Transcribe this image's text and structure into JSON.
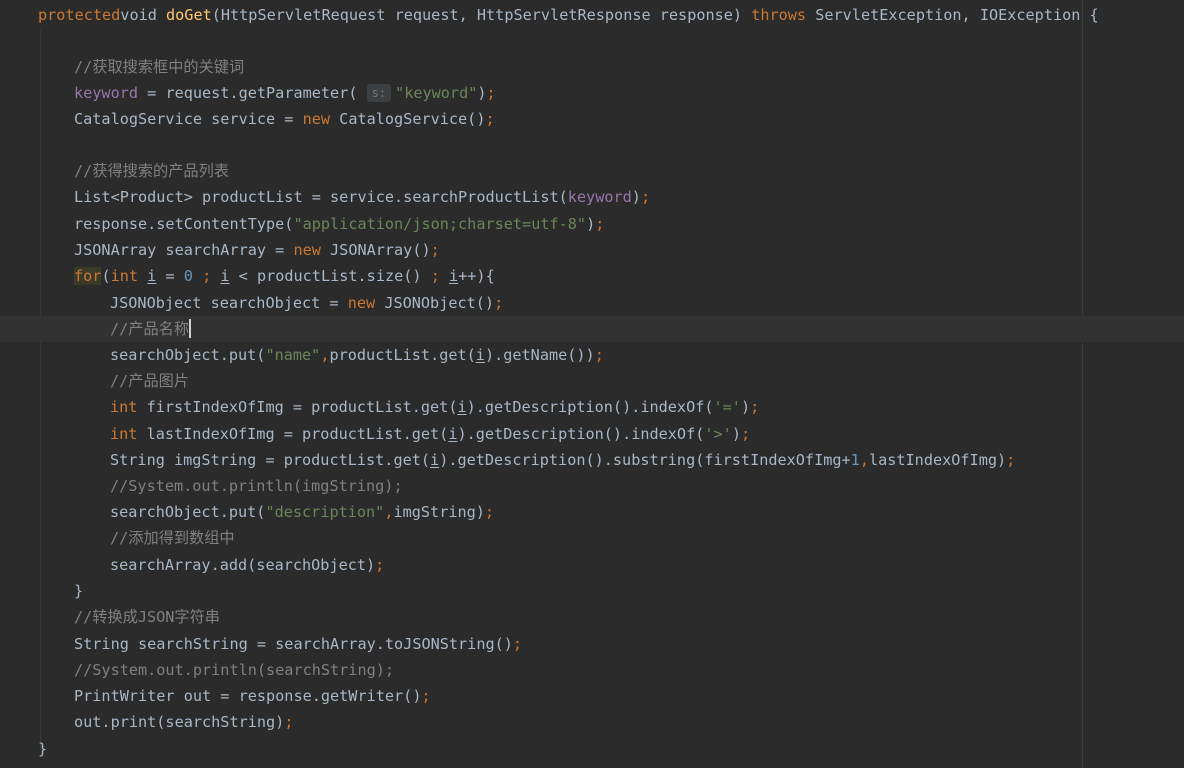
{
  "editor": {
    "theme": "darcula",
    "colors": {
      "background": "#2b2b2b",
      "keyword": "#cc7832",
      "method_declaration": "#ffc66d",
      "string": "#6a8759",
      "number": "#6897bb",
      "comment": "#808080",
      "field": "#9876aa",
      "text": "#a9b7c6"
    },
    "parameter_hint": "s:",
    "lines": [
      {
        "tokens": [
          [
            "kw",
            "protected"
          ],
          [
            "",
            "void "
          ],
          [
            "fn",
            "doGet"
          ],
          [
            "",
            "(HttpServletRequest request, HttpServletResponse response) "
          ],
          [
            "kw",
            "throws"
          ],
          [
            "",
            " ServletException, IOException {"
          ]
        ]
      },
      {
        "tokens": []
      },
      {
        "tokens": [
          [
            "cmt",
            "//获取搜索框中的关键词"
          ]
        ]
      },
      {
        "tokens": [
          [
            "fld",
            "keyword"
          ],
          [
            "",
            " = request.getParameter( "
          ],
          [
            "hint",
            "s:"
          ],
          [
            "str",
            "\"keyword\""
          ],
          [
            "",
            ")"
          ],
          [
            "kw",
            ";"
          ]
        ]
      },
      {
        "tokens": [
          [
            "",
            "CatalogService service = "
          ],
          [
            "kw",
            "new"
          ],
          [
            "",
            " CatalogService()"
          ],
          [
            "kw",
            ";"
          ]
        ]
      },
      {
        "tokens": []
      },
      {
        "tokens": [
          [
            "cmt",
            "//获得搜索的产品列表"
          ]
        ]
      },
      {
        "tokens": [
          [
            "",
            "List<Product> productList = service.searchProductList("
          ],
          [
            "fld",
            "keyword"
          ],
          [
            "",
            ")"
          ],
          [
            "kw",
            ";"
          ]
        ]
      },
      {
        "tokens": [
          [
            "",
            "response.setContentType("
          ],
          [
            "str",
            "\"application/json;charset=utf-8\""
          ],
          [
            "",
            ")"
          ],
          [
            "kw",
            ";"
          ]
        ]
      },
      {
        "tokens": [
          [
            "",
            "JSONArray searchArray = "
          ],
          [
            "kw",
            "new"
          ],
          [
            "",
            " JSONArray()"
          ],
          [
            "kw",
            ";"
          ]
        ]
      },
      {
        "tokens": [
          [
            "kw hl",
            "for"
          ],
          [
            "",
            "("
          ],
          [
            "kw",
            "int "
          ],
          [
            "ul",
            "i"
          ],
          [
            "",
            " = "
          ],
          [
            "num",
            "0"
          ],
          [
            "kw",
            " ; "
          ],
          [
            "ul",
            "i"
          ],
          [
            "",
            " < productList.size() "
          ],
          [
            "kw",
            "; "
          ],
          [
            "ul",
            "i"
          ],
          [
            "",
            "++){"
          ]
        ]
      },
      {
        "tokens": [
          [
            "",
            "JSONObject searchObject = "
          ],
          [
            "kw",
            "new"
          ],
          [
            "",
            " JSONObject()"
          ],
          [
            "kw",
            ";"
          ]
        ]
      },
      {
        "tokens": [
          [
            "cmt",
            "//产品名称"
          ],
          [
            "caret",
            ""
          ]
        ]
      },
      {
        "tokens": [
          [
            "",
            "searchObject.put("
          ],
          [
            "str",
            "\"name\""
          ],
          [
            "kw",
            ","
          ],
          [
            "",
            "productList.get("
          ],
          [
            "ul",
            "i"
          ],
          [
            "",
            ").getName())"
          ],
          [
            "kw",
            ";"
          ]
        ]
      },
      {
        "tokens": [
          [
            "cmt",
            "//产品图片"
          ]
        ]
      },
      {
        "tokens": [
          [
            "kw",
            "int "
          ],
          [
            "",
            "firstIndexOfImg = productList.get("
          ],
          [
            "ul",
            "i"
          ],
          [
            "",
            ").getDescription().indexOf("
          ],
          [
            "str",
            "'='"
          ],
          [
            "",
            ")"
          ],
          [
            "kw",
            ";"
          ]
        ]
      },
      {
        "tokens": [
          [
            "kw",
            "int "
          ],
          [
            "",
            "lastIndexOfImg = productList.get("
          ],
          [
            "ul",
            "i"
          ],
          [
            "",
            ").getDescription().indexOf("
          ],
          [
            "str",
            "'>'"
          ],
          [
            "",
            ")"
          ],
          [
            "kw",
            ";"
          ]
        ]
      },
      {
        "tokens": [
          [
            "",
            "String imgString = productList.get("
          ],
          [
            "ul",
            "i"
          ],
          [
            "",
            ").getDescription().substring(firstIndexOfImg+"
          ],
          [
            "num",
            "1"
          ],
          [
            "kw",
            ","
          ],
          [
            "",
            "lastIndexOfImg)"
          ],
          [
            "kw",
            ";"
          ]
        ]
      },
      {
        "tokens": [
          [
            "cmt",
            "//System.out.println(imgString);"
          ]
        ]
      },
      {
        "tokens": [
          [
            "",
            "searchObject.put("
          ],
          [
            "str",
            "\"description\""
          ],
          [
            "kw",
            ","
          ],
          [
            "",
            "imgString)"
          ],
          [
            "kw",
            ";"
          ]
        ]
      },
      {
        "tokens": [
          [
            "cmt",
            "//添加得到数组中"
          ]
        ]
      },
      {
        "tokens": [
          [
            "",
            "searchArray.add(searchObject)"
          ],
          [
            "kw",
            ";"
          ]
        ]
      },
      {
        "tokens": [
          [
            "",
            "}"
          ]
        ]
      },
      {
        "tokens": [
          [
            "cmt",
            "//转换成JSON字符串"
          ]
        ]
      },
      {
        "tokens": [
          [
            "",
            "String searchString = searchArray.toJSONString()"
          ],
          [
            "kw",
            ";"
          ]
        ]
      },
      {
        "tokens": [
          [
            "cmt",
            "//System.out.println(searchString);"
          ]
        ]
      },
      {
        "tokens": [
          [
            "",
            "PrintWriter out = response.getWriter()"
          ],
          [
            "kw",
            ";"
          ]
        ]
      },
      {
        "tokens": [
          [
            "",
            "out.print(searchString)"
          ],
          [
            "kw",
            ";"
          ]
        ]
      },
      {
        "tokens": [
          [
            "",
            "}"
          ]
        ]
      }
    ]
  }
}
